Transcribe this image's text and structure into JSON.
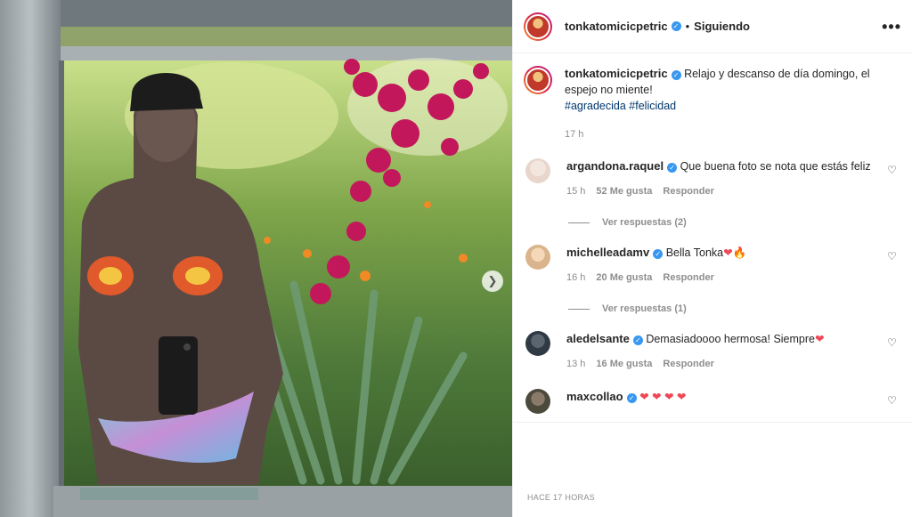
{
  "post": {
    "username": "tonkatomicicpetric",
    "separator": "•",
    "follow_status": "Siguiendo",
    "more_label": "•••",
    "caption_text": "Relajo y descanso de día domingo, el espejo no miente!",
    "hashtags": [
      "#agradecida",
      "#felicidad"
    ],
    "caption_time": "17 h",
    "posted_ago": "HACE 17 HORAS"
  },
  "icons": {
    "verified": "verified-badge-icon",
    "like": "heart-outline-icon",
    "carousel_next": "chevron-right-icon"
  },
  "colors": {
    "verified": "#3897f0",
    "hashtag": "#00376b",
    "muted": "#8e8e8e",
    "heart": "#ed4956"
  },
  "comments": [
    {
      "username": "argandona.raquel",
      "text": "Que buena foto se nota que estás feliz",
      "time": "15 h",
      "likes": "52 Me gusta",
      "reply_label": "Responder",
      "view_replies": "Ver respuestas (2)"
    },
    {
      "username": "michelleadamv",
      "text": "Bella Tonka",
      "emoji": "❤🔥",
      "time": "16 h",
      "likes": "20 Me gusta",
      "reply_label": "Responder",
      "view_replies": "Ver respuestas (1)"
    },
    {
      "username": "aledelsante",
      "text": "Demasiadoooo hermosa! Siempre",
      "emoji": "❤",
      "time": "13 h",
      "likes": "16 Me gusta",
      "reply_label": "Responder"
    },
    {
      "username": "maxcollao",
      "text": "",
      "emoji": "❤ ❤ ❤ ❤"
    }
  ]
}
